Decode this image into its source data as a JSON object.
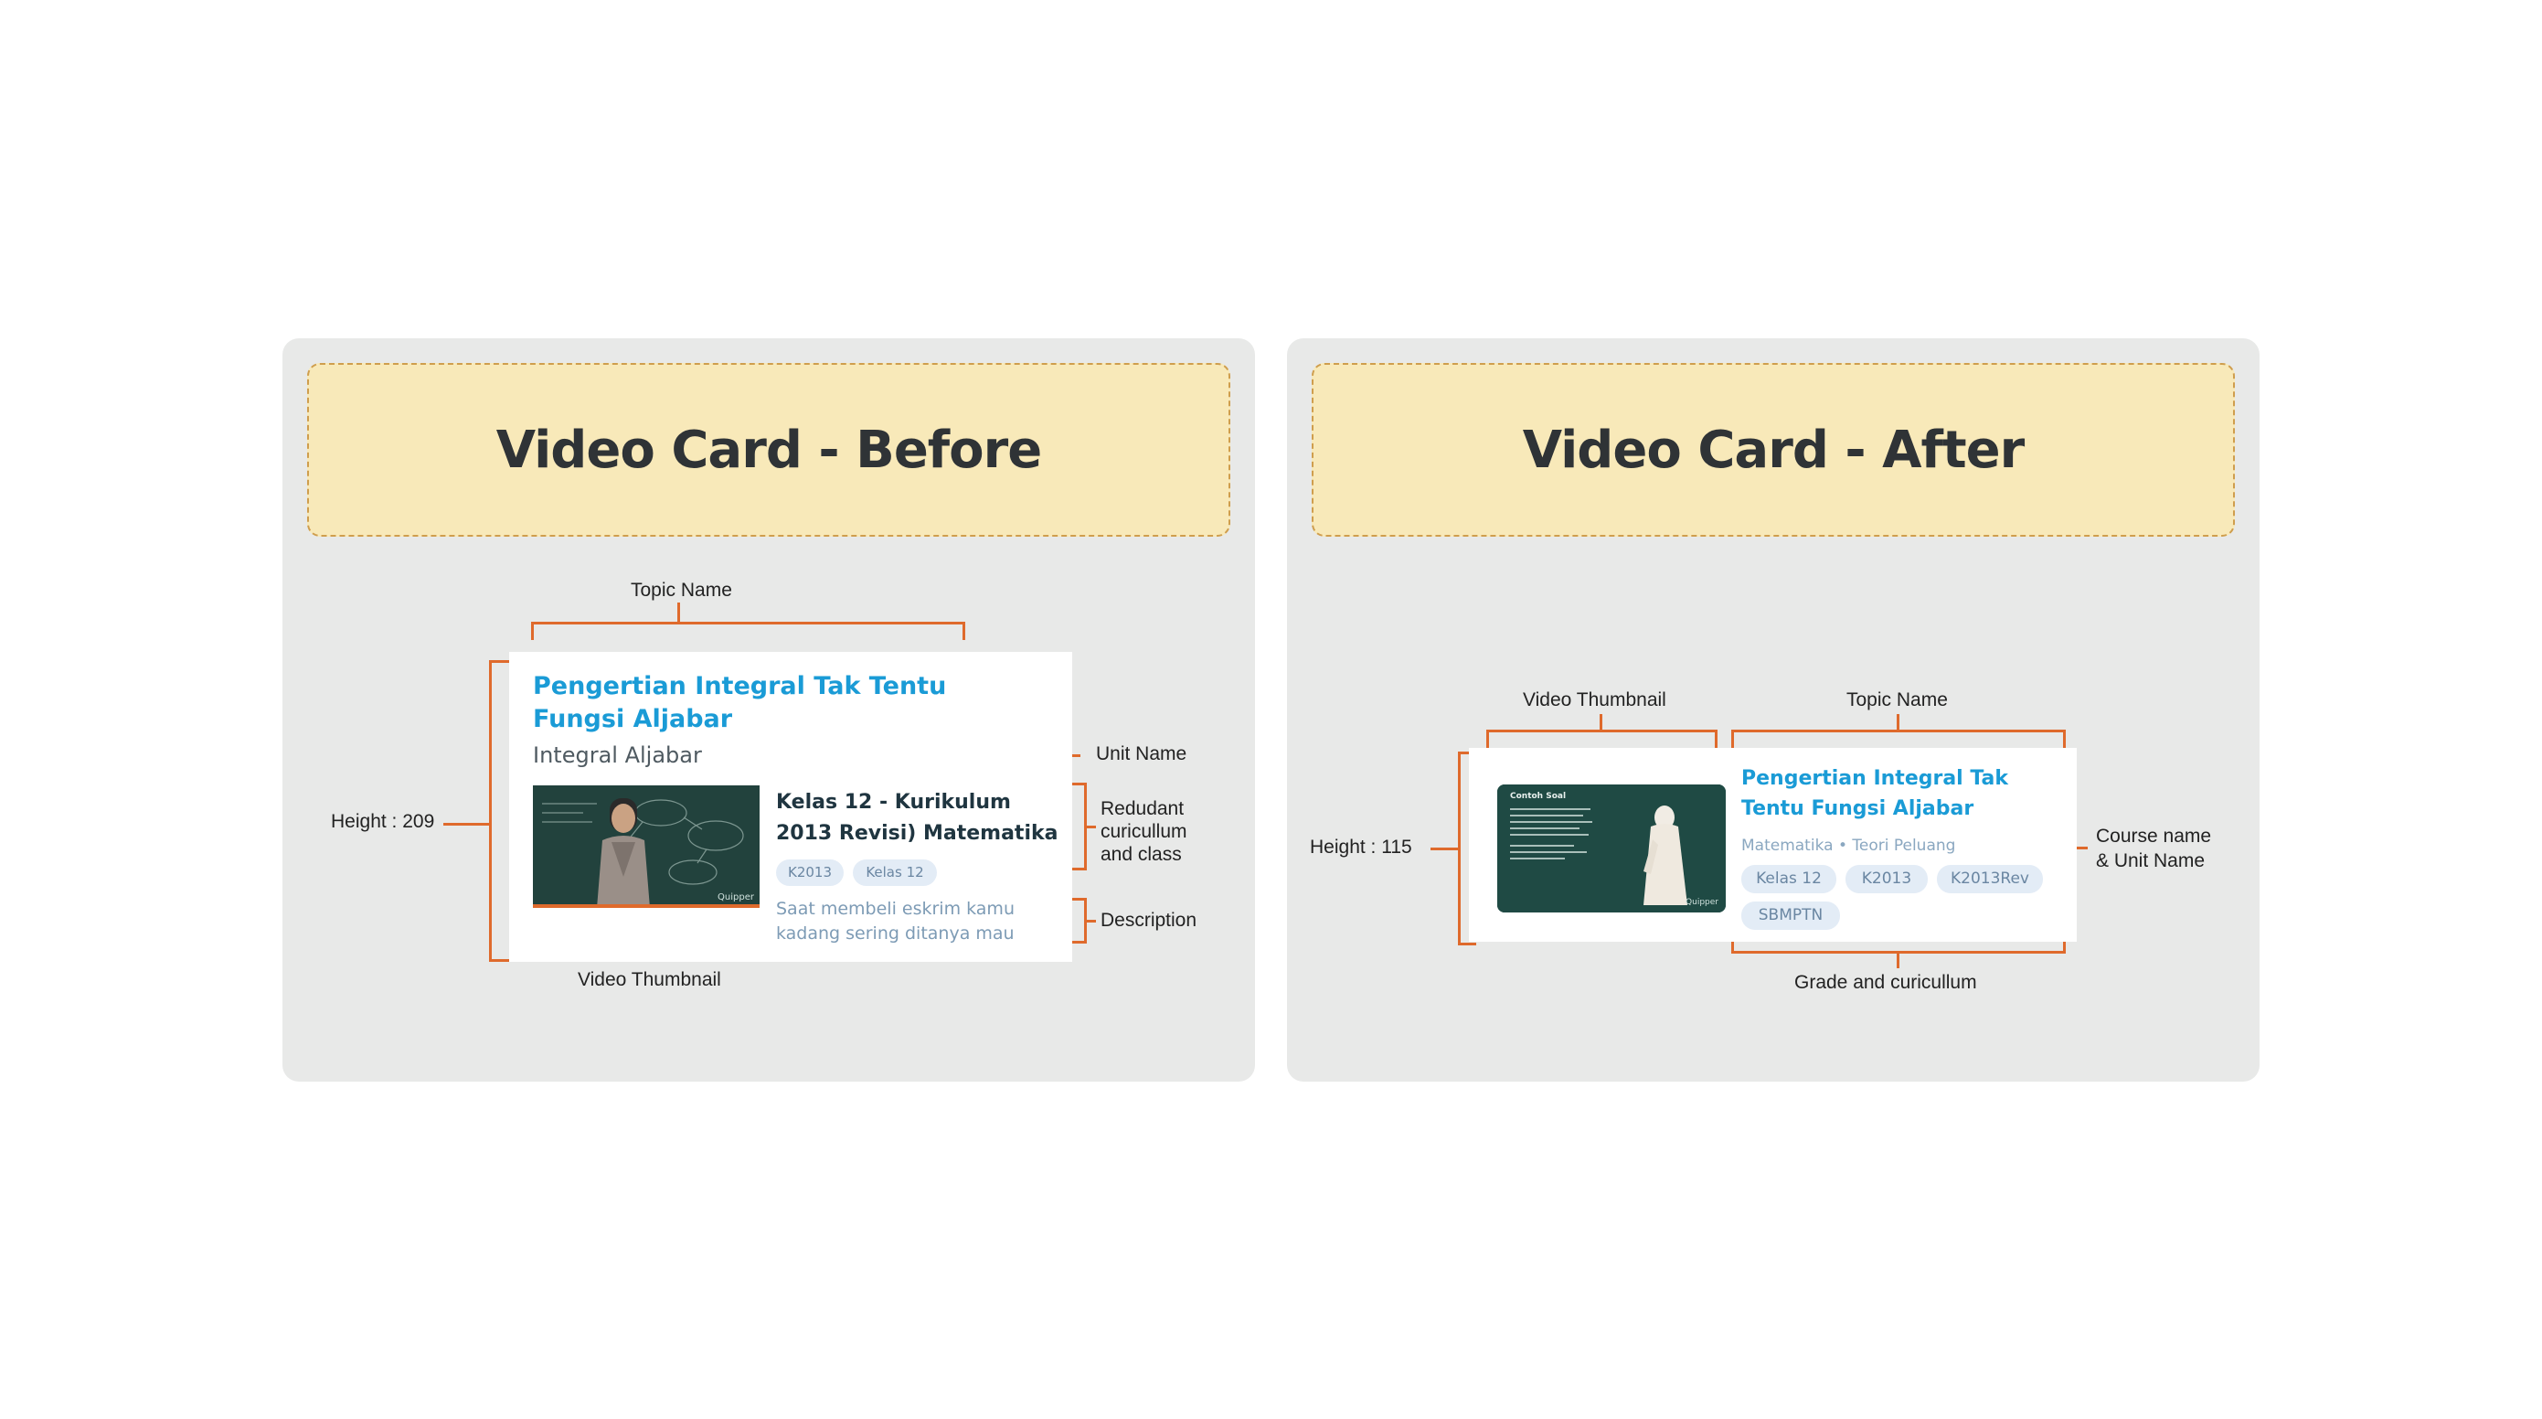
{
  "before": {
    "title": "Video Card - Before",
    "card": {
      "topic_name": "Pengertian Integral Tak Tentu Fungsi Aljabar",
      "unit_name": "Integral Aljabar",
      "course_title": "Kelas 12 - Kurikulum 2013 Revisi) Matematika",
      "chips": [
        "K2013",
        "Kelas 12"
      ],
      "description": "Saat membeli eskrim kamu kadang sering ditanya mau",
      "thumbnail_watermark": "Quipper"
    },
    "annotations": {
      "topic_name": "Topic Name",
      "unit_name": "Unit Name",
      "redundant_line1": "Redudant",
      "redundant_line2": "curicullum",
      "redundant_line3": "and class",
      "description": "Description",
      "height": "Height :  209",
      "video_thumbnail": "Video Thumbnail"
    }
  },
  "after": {
    "title": "Video Card - After",
    "card": {
      "topic_name": "Pengertian Integral Tak Tentu Fungsi Aljabar",
      "course_unit": "Matematika • Teori Peluang",
      "chips": [
        "Kelas 12",
        "K2013",
        "K2013Rev",
        "SBMPTN"
      ],
      "thumbnail_heading": "Contoh Soal",
      "thumbnail_watermark": "Quipper"
    },
    "annotations": {
      "video_thumbnail": "Video Thumbnail",
      "topic_name": "Topic Name",
      "course_unit_line1": "Course name",
      "course_unit_line2": "& Unit Name",
      "height": "Height :  115",
      "grade_curriculum": "Grade and curicullum"
    }
  },
  "colors": {
    "panel_bg": "#e8e9e8",
    "title_bg": "#f8e9b9",
    "title_border": "#cf9e4d",
    "annotation_orange": "#df6a2c",
    "topic_blue": "#1a9bd6",
    "chip_bg": "#e3ecf6",
    "chip_text": "#6a86a2",
    "chalkboard": "#1f4a44"
  }
}
